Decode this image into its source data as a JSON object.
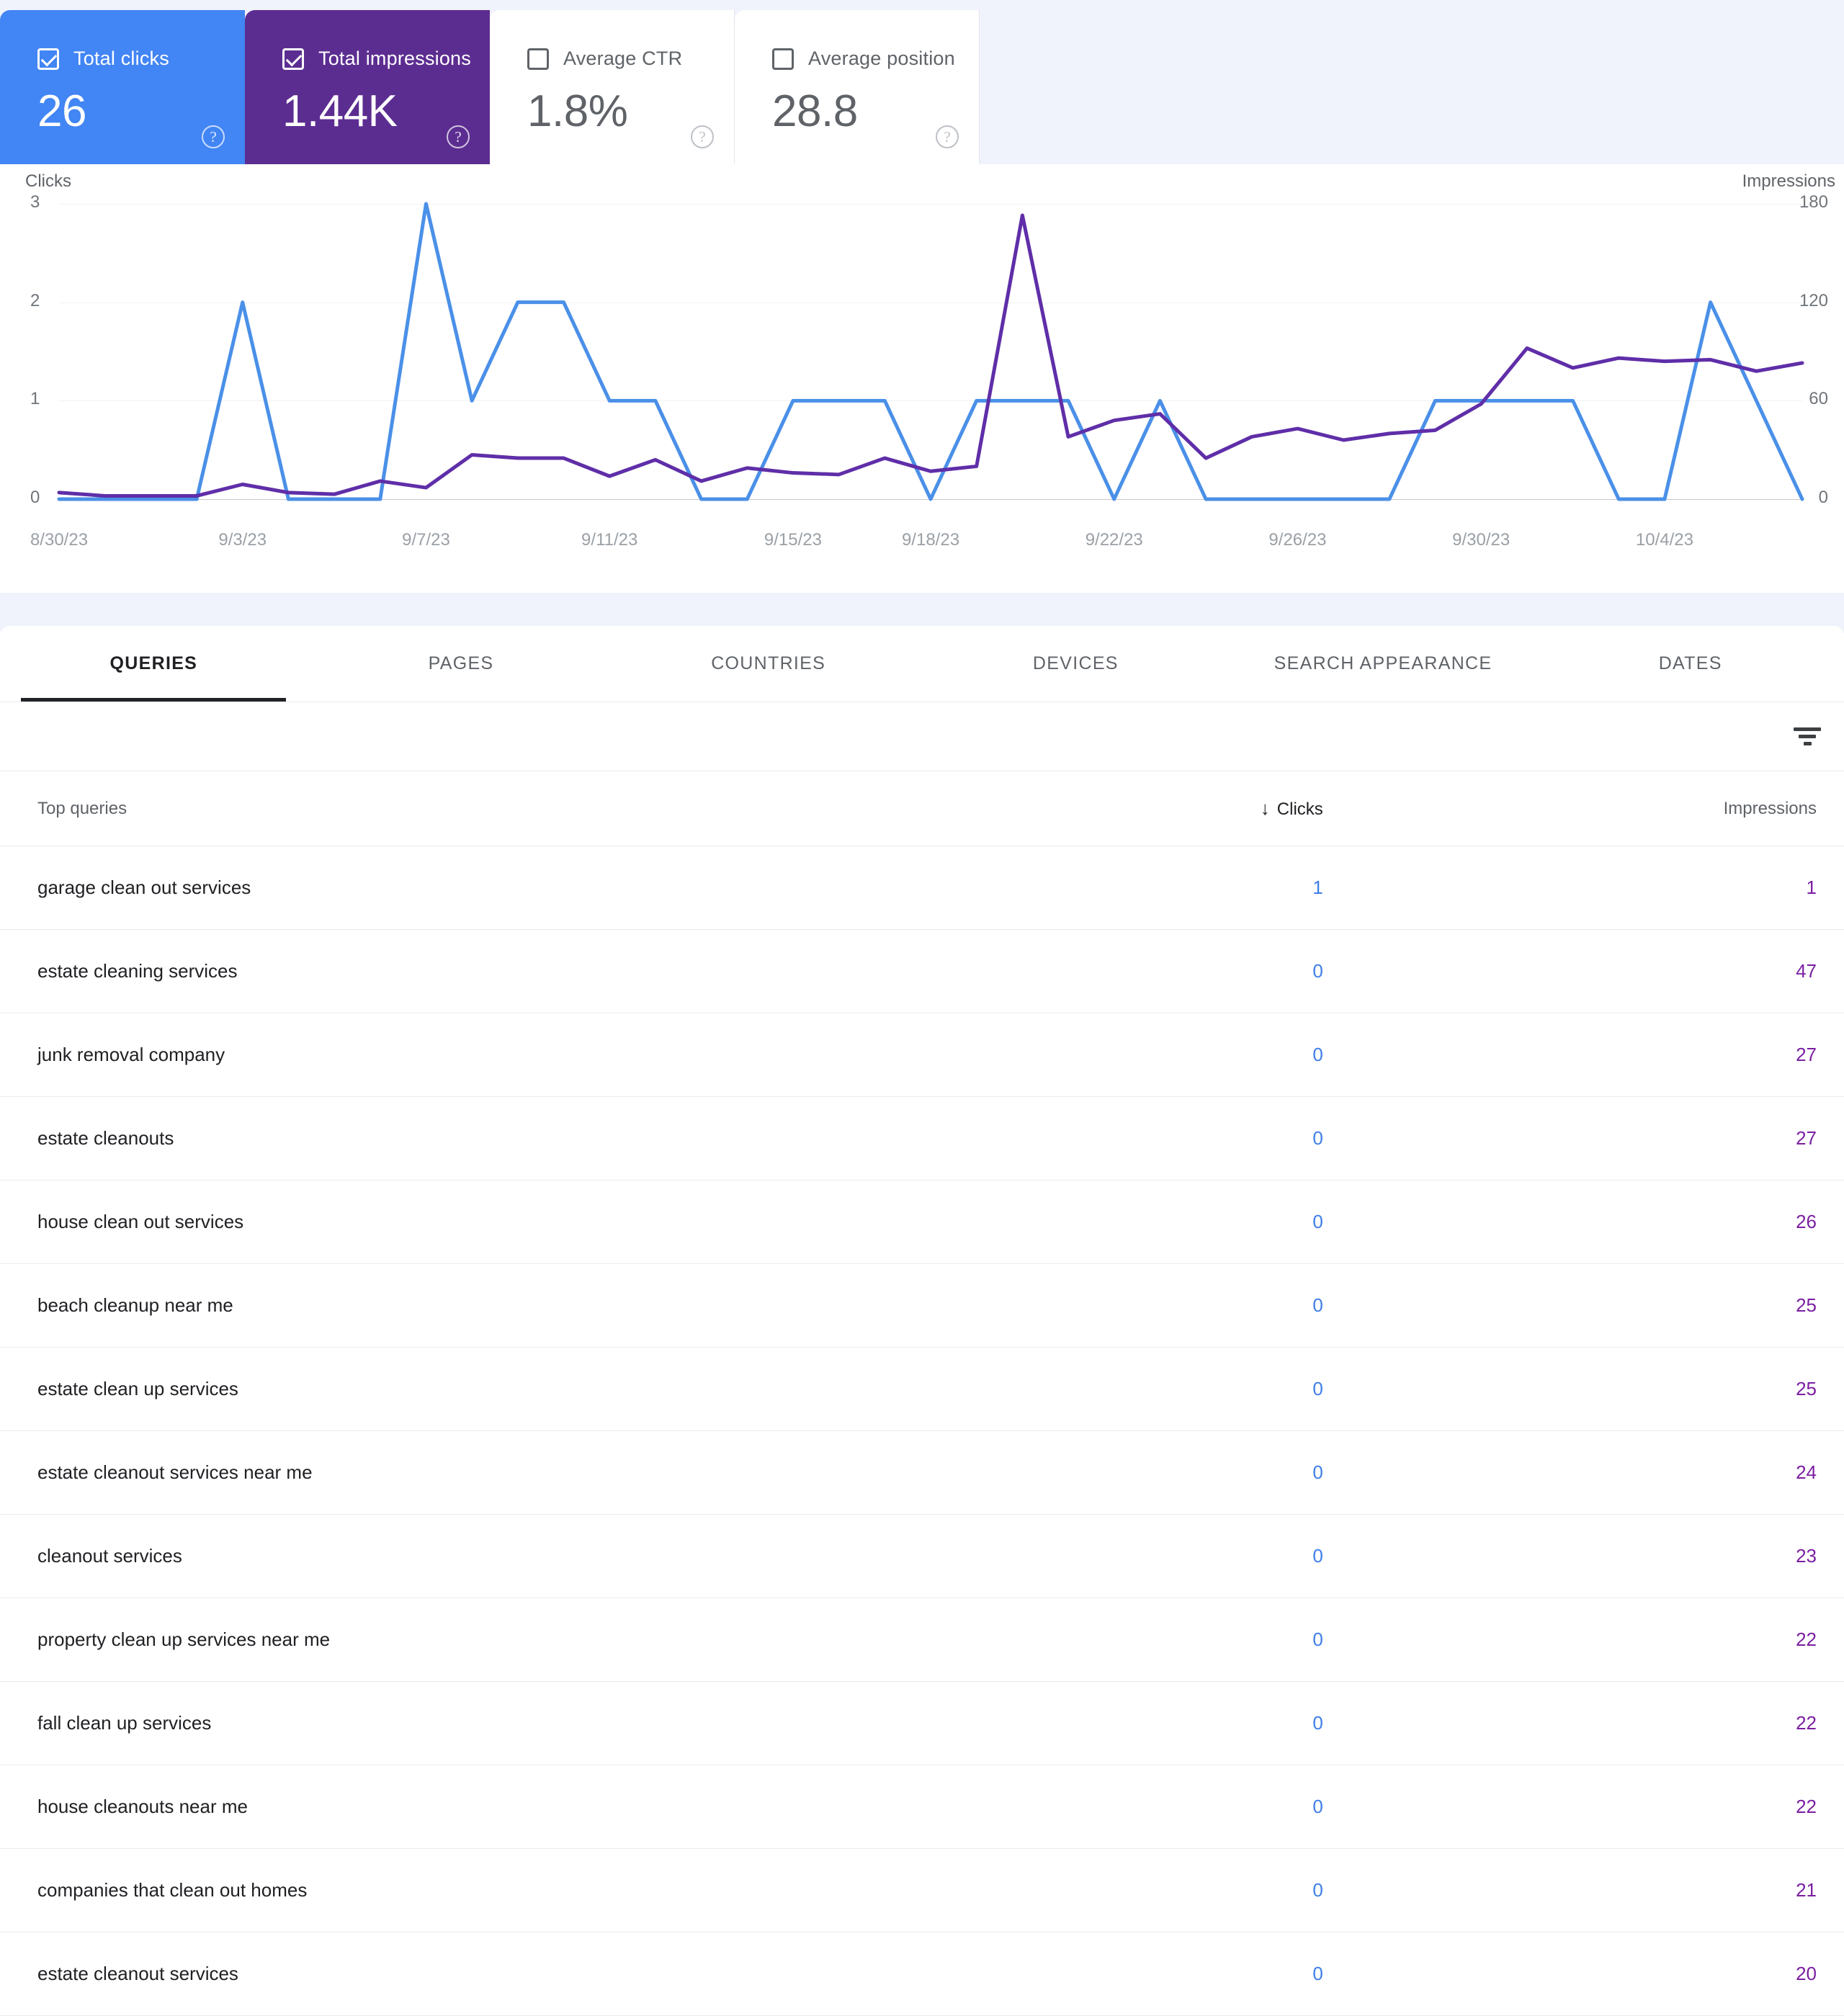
{
  "metric_cards": [
    {
      "label": "Total clicks",
      "value": "26",
      "checked": true,
      "theme": "clicks",
      "help": "?"
    },
    {
      "label": "Total impressions",
      "value": "1.44K",
      "checked": true,
      "theme": "impressions",
      "help": "?"
    },
    {
      "label": "Average CTR",
      "value": "1.8%",
      "checked": false,
      "theme": "ctr",
      "help": "?"
    },
    {
      "label": "Average position",
      "value": "28.8",
      "checked": false,
      "theme": "position",
      "help": "?"
    }
  ],
  "colors": {
    "clicks": "#4285f4",
    "impressions": "#5c2d91",
    "clicks_line": "#4a90e8",
    "impressions_line": "#5f2ea8",
    "page_bg": "#f1f3fc"
  },
  "chart_data": {
    "type": "line",
    "title": "",
    "ylabel": "Clicks",
    "y2label": "Impressions",
    "xlabel": "",
    "grid": true,
    "legend": "none",
    "ylim": [
      0,
      3
    ],
    "y2lim": [
      0,
      180
    ],
    "yticks": [
      "0",
      "1",
      "2",
      "3"
    ],
    "y2ticks": [
      "0",
      "60",
      "120",
      "180"
    ],
    "xticks": [
      "8/30/23",
      "9/3/23",
      "9/7/23",
      "9/11/23",
      "9/15/23",
      "9/18/23",
      "9/22/23",
      "9/26/23",
      "9/30/23",
      "10/4/23"
    ],
    "x": [
      "8/30/23",
      "8/31/23",
      "9/1/23",
      "9/2/23",
      "9/3/23",
      "9/4/23",
      "9/5/23",
      "9/6/23",
      "9/7/23",
      "9/8/23",
      "9/9/23",
      "9/10/23",
      "9/11/23",
      "9/12/23",
      "9/13/23",
      "9/14/23",
      "9/15/23",
      "9/16/23",
      "9/17/23",
      "9/18/23",
      "9/19/23",
      "9/20/23",
      "9/21/23",
      "9/22/23",
      "9/23/23",
      "9/24/23",
      "9/25/23",
      "9/26/23",
      "9/27/23",
      "9/28/23",
      "9/29/23",
      "9/30/23",
      "10/1/23",
      "10/2/23",
      "10/3/23",
      "10/4/23",
      "10/5/23",
      "10/6/23",
      "10/7/23"
    ],
    "series": [
      {
        "name": "Clicks",
        "axis": "left",
        "color": "#4a90e8",
        "values": [
          0,
          0,
          0,
          0,
          2,
          0,
          0,
          0,
          3,
          1,
          2,
          2,
          1,
          1,
          0,
          0,
          1,
          1,
          1,
          0,
          1,
          1,
          1,
          0,
          1,
          0,
          0,
          0,
          0,
          0,
          1,
          1,
          1,
          1,
          0,
          0,
          2,
          1,
          0
        ]
      },
      {
        "name": "Impressions",
        "axis": "right",
        "color": "#5f2ea8",
        "values": [
          4,
          2,
          2,
          2,
          9,
          4,
          3,
          11,
          7,
          27,
          25,
          25,
          14,
          24,
          11,
          19,
          16,
          15,
          25,
          17,
          20,
          173,
          38,
          48,
          52,
          25,
          38,
          43,
          36,
          40,
          42,
          58,
          92,
          80,
          86,
          84,
          85,
          78,
          83
        ]
      }
    ]
  },
  "tabs": [
    {
      "label": "QUERIES",
      "active": true
    },
    {
      "label": "PAGES",
      "active": false
    },
    {
      "label": "COUNTRIES",
      "active": false
    },
    {
      "label": "DEVICES",
      "active": false
    },
    {
      "label": "SEARCH APPEARANCE",
      "active": false
    },
    {
      "label": "DATES",
      "active": false
    }
  ],
  "filter": {
    "icon": "filter-icon"
  },
  "table": {
    "columns": {
      "query": "Top queries",
      "clicks": "Clicks",
      "impressions": "Impressions",
      "sort_arrow": "↓"
    },
    "rows": [
      {
        "query": "garage clean out services",
        "clicks": "1",
        "impressions": "1"
      },
      {
        "query": "estate cleaning services",
        "clicks": "0",
        "impressions": "47"
      },
      {
        "query": "junk removal company",
        "clicks": "0",
        "impressions": "27"
      },
      {
        "query": "estate cleanouts",
        "clicks": "0",
        "impressions": "27"
      },
      {
        "query": "house clean out services",
        "clicks": "0",
        "impressions": "26"
      },
      {
        "query": "beach cleanup near me",
        "clicks": "0",
        "impressions": "25"
      },
      {
        "query": "estate clean up services",
        "clicks": "0",
        "impressions": "25"
      },
      {
        "query": "estate cleanout services near me",
        "clicks": "0",
        "impressions": "24"
      },
      {
        "query": "cleanout services",
        "clicks": "0",
        "impressions": "23"
      },
      {
        "query": "property clean up services near me",
        "clicks": "0",
        "impressions": "22"
      },
      {
        "query": "fall clean up services",
        "clicks": "0",
        "impressions": "22"
      },
      {
        "query": "house cleanouts near me",
        "clicks": "0",
        "impressions": "22"
      },
      {
        "query": "companies that clean out homes",
        "clicks": "0",
        "impressions": "21"
      },
      {
        "query": "estate cleanout services",
        "clicks": "0",
        "impressions": "20"
      }
    ]
  }
}
